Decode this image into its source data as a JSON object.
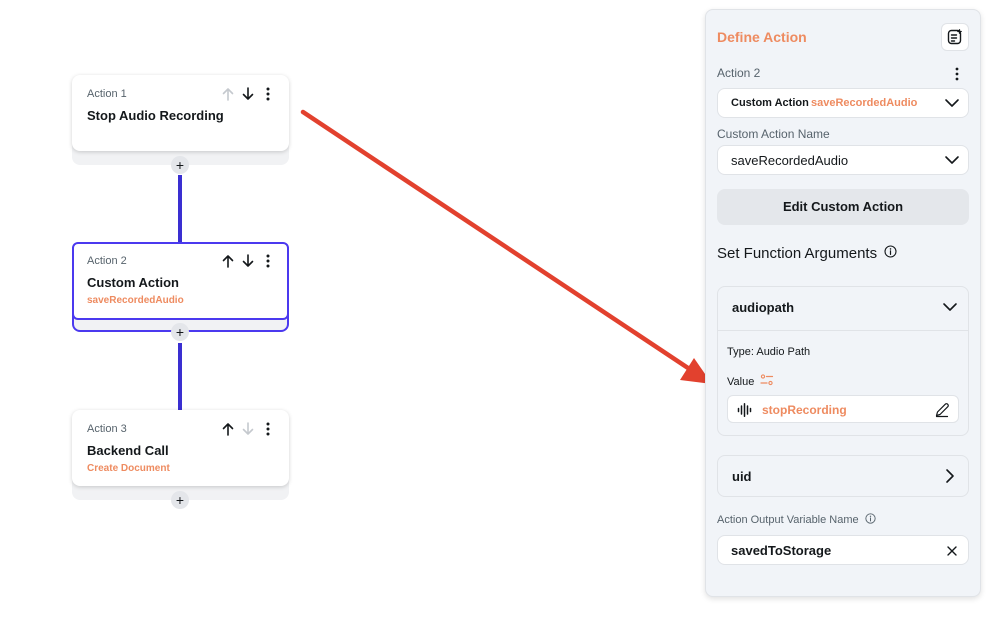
{
  "canvas": {
    "actions": [
      {
        "step": "Action 1",
        "title": "Stop Audio Recording",
        "subtitle": ""
      },
      {
        "step": "Action 2",
        "title": "Custom Action",
        "subtitle": "saveRecordedAudio"
      },
      {
        "step": "Action 3",
        "title": "Backend Call",
        "subtitle": "Create Document"
      }
    ],
    "add_symbol": "+"
  },
  "panel": {
    "title": "Define Action",
    "action_label": "Action 2",
    "action_type": {
      "type": "Custom Action",
      "name": "saveRecordedAudio"
    },
    "custom_action_name_label": "Custom Action Name",
    "custom_action_name_value": "saveRecordedAudio",
    "edit_button": "Edit Custom Action",
    "section_title": "Set Function Arguments",
    "arguments": [
      {
        "name": "audiopath",
        "type_text": "Type: Audio Path",
        "value_label": "Value",
        "value": "stopRecording"
      },
      {
        "name": "uid"
      }
    ],
    "output_label": "Action Output Variable Name",
    "output_value": "savedToStorage"
  },
  "colors": {
    "accent": "#ee8b60",
    "primary": "#4b39ef",
    "connector": "#3a2fd1",
    "arrow": "#e2412e"
  }
}
